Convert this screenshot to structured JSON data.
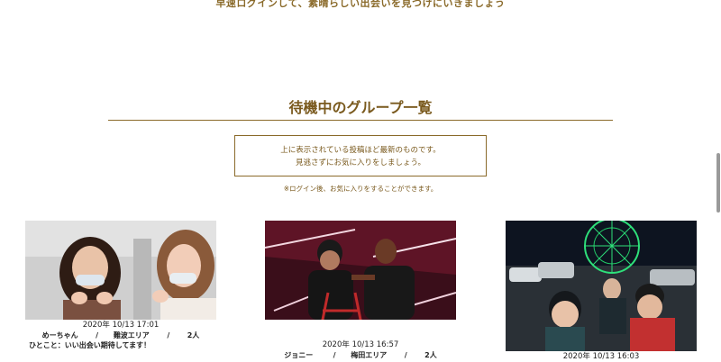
{
  "top_banner": "早速ログインして、素晴らしい出会いを見つけにいきましょう",
  "section_title": "待機中のグループ一覧",
  "notice": {
    "line1": "上に表示されている投稿ほど最新のものです。",
    "line2": "見逃さずにお気に入りをしましょう。"
  },
  "note": "※ログイン後、お気に入りをすることができます。",
  "cards": [
    {
      "datetime": "2020年 10/13 17:01",
      "name": "めーちゃん",
      "area": "難波エリア",
      "count": "2人",
      "comment": "ひとこと：いい出会い期待してます！"
    },
    {
      "datetime": "2020年 10/13 16:57",
      "name": "ジョニー",
      "area": "梅田エリア",
      "count": "2人",
      "comment": ""
    },
    {
      "datetime": "2020年 10/13 16:03",
      "name": "",
      "area": "",
      "count": "",
      "comment": ""
    }
  ],
  "separator": "/"
}
